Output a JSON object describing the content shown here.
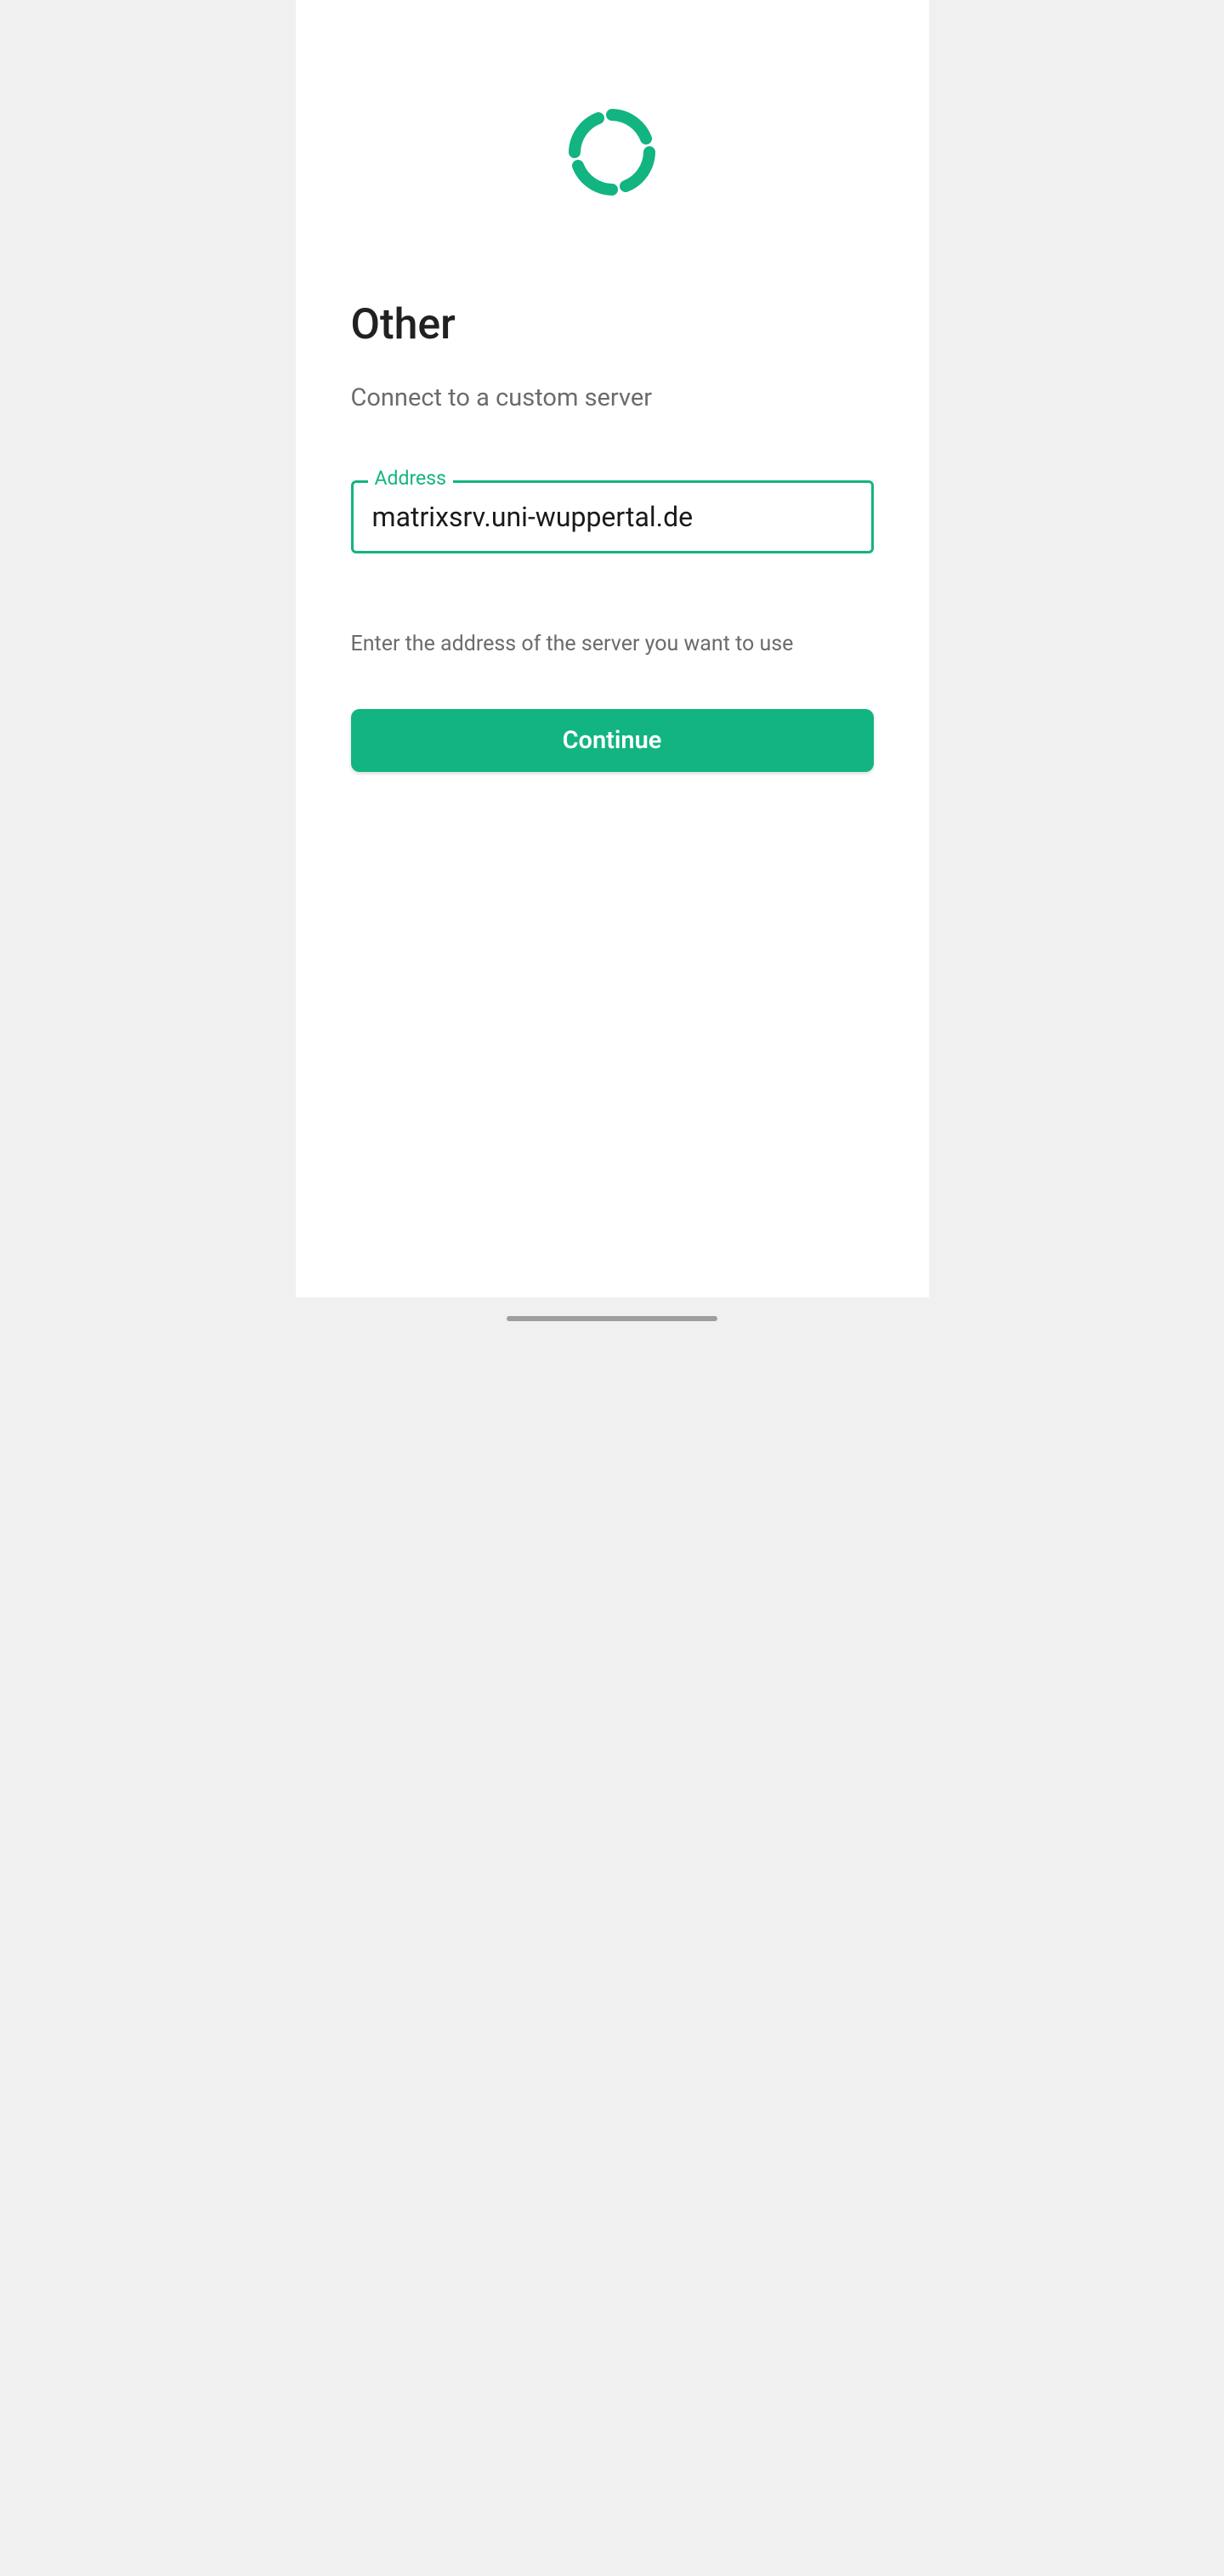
{
  "title": "Other",
  "subtitle": "Connect to a custom server",
  "field": {
    "label": "Address",
    "value": "matrixsrv.uni-wuppertal.de"
  },
  "helper": "Enter the address of the server you want to use",
  "continue_label": "Continue",
  "colors": {
    "accent": "#12b481"
  }
}
